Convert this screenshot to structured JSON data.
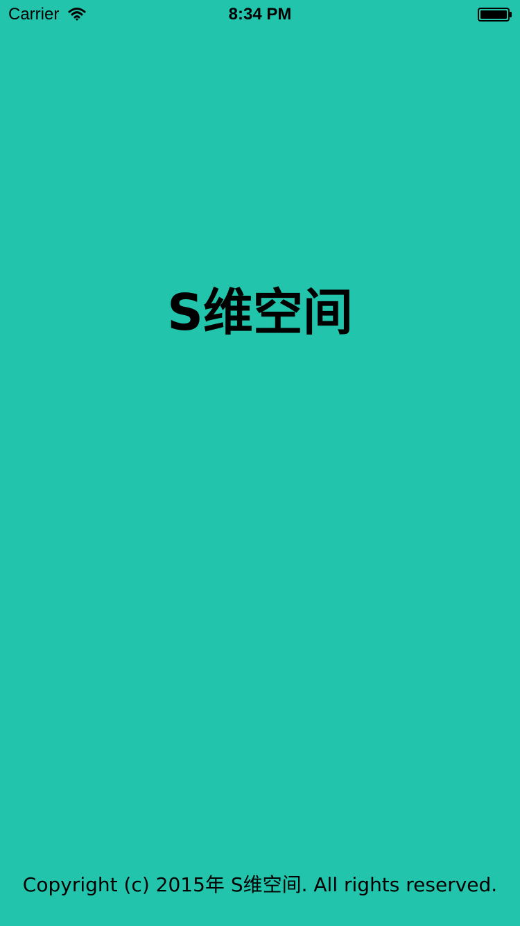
{
  "status_bar": {
    "carrier": "Carrier",
    "time": "8:34 PM",
    "wifi_icon": "wifi-icon",
    "battery_icon": "battery-icon"
  },
  "splash": {
    "title": "S维空间",
    "copyright": "Copyright (c) 2015年 S维空间. All rights reserved."
  },
  "colors": {
    "background": "#23c4ac",
    "text": "#000000"
  }
}
